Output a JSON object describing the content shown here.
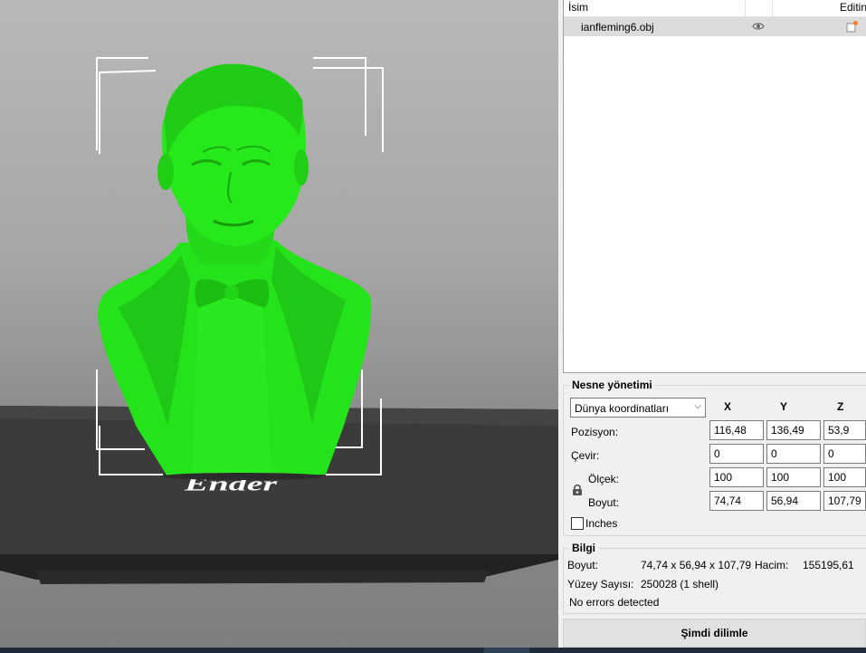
{
  "viewport": {
    "bed_brand": "Ender",
    "model_color": "#22e61c"
  },
  "object_list": {
    "column_name": "İsim",
    "column_edit": "Editin",
    "row_name": "ianfleming6.obj"
  },
  "object_management": {
    "title": "Nesne yönetimi",
    "coord_system": "Dünya koordinatları",
    "axes": [
      "X",
      "Y",
      "Z"
    ],
    "position_label": "Pozisyon:",
    "position": [
      "116,48",
      "136,49",
      "53,9"
    ],
    "rotate_label": "Çevir:",
    "rotate": [
      "0",
      "0",
      "0"
    ],
    "scale_label": "Ölçek:",
    "scale": [
      "100",
      "100",
      "100"
    ],
    "size_label": "Boyut:",
    "size": [
      "74,74",
      "56,94",
      "107,79"
    ],
    "inches_label": "Inches"
  },
  "info": {
    "title": "Bilgi",
    "size_label": "Boyut:",
    "size_value": "74,74 x 56,94 x 107,79",
    "volume_label": "Hacim:",
    "volume_value": "155195,61",
    "facets_label": "Yüzey Sayısı:",
    "facets_value": "250028 (1 shell)",
    "errors": "No errors detected"
  },
  "slice_button": "Şimdi dilimle"
}
